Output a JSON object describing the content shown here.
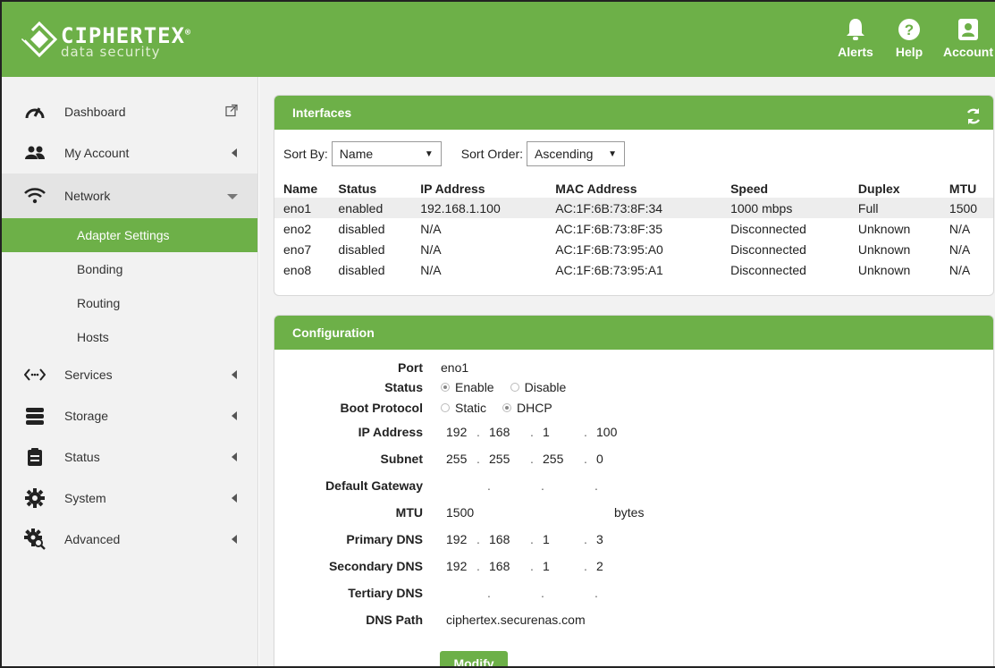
{
  "brand": {
    "name": "CIPHERTEX",
    "tagline": "data security",
    "registered": "®"
  },
  "header": {
    "alerts_label": "Alerts",
    "help_label": "Help",
    "account_label": "Account"
  },
  "sidebar": {
    "items": [
      {
        "label": "Dashboard",
        "icon": "speedometer-icon"
      },
      {
        "label": "My Account",
        "icon": "users-icon"
      },
      {
        "label": "Network",
        "icon": "wifi-icon"
      },
      {
        "label": "Services",
        "icon": "code-icon"
      },
      {
        "label": "Storage",
        "icon": "server-icon"
      },
      {
        "label": "Status",
        "icon": "clipboard-icon"
      },
      {
        "label": "System",
        "icon": "gear-icon"
      },
      {
        "label": "Advanced",
        "icon": "gear-search-icon"
      }
    ],
    "network_subitems": [
      "Adapter Settings",
      "Bonding",
      "Routing",
      "Hosts"
    ],
    "active_subitem": "Adapter Settings"
  },
  "interfaces": {
    "title": "Interfaces",
    "sort_by_label": "Sort By:",
    "sort_by_value": "Name",
    "sort_order_label": "Sort Order:",
    "sort_order_value": "Ascending",
    "columns": [
      "Name",
      "Status",
      "IP Address",
      "MAC Address",
      "Speed",
      "Duplex",
      "MTU"
    ],
    "rows": [
      [
        "eno1",
        "enabled",
        "192.168.1.100",
        "AC:1F:6B:73:8F:34",
        "1000 mbps",
        "Full",
        "1500"
      ],
      [
        "eno2",
        "disabled",
        "N/A",
        "AC:1F:6B:73:8F:35",
        "Disconnected",
        "Unknown",
        "N/A"
      ],
      [
        "eno7",
        "disabled",
        "N/A",
        "AC:1F:6B:73:95:A0",
        "Disconnected",
        "Unknown",
        "N/A"
      ],
      [
        "eno8",
        "disabled",
        "N/A",
        "AC:1F:6B:73:95:A1",
        "Disconnected",
        "Unknown",
        "N/A"
      ]
    ]
  },
  "configuration": {
    "title": "Configuration",
    "labels": {
      "port": "Port",
      "status": "Status",
      "boot_protocol": "Boot Protocol",
      "ip_address": "IP Address",
      "subnet": "Subnet",
      "default_gateway": "Default Gateway",
      "mtu": "MTU",
      "primary_dns": "Primary DNS",
      "secondary_dns": "Secondary DNS",
      "tertiary_dns": "Tertiary DNS",
      "dns_path": "DNS Path"
    },
    "port": "eno1",
    "status_options": [
      "Enable",
      "Disable"
    ],
    "status_selected": "Enable",
    "boot_options": [
      "Static",
      "DHCP"
    ],
    "boot_selected": "DHCP",
    "ip_address": [
      "192",
      "168",
      "1",
      "100"
    ],
    "subnet": [
      "255",
      "255",
      "255",
      "0"
    ],
    "default_gateway": [
      "",
      "",
      "",
      ""
    ],
    "mtu": "1500",
    "mtu_unit": "bytes",
    "primary_dns": [
      "192",
      "168",
      "1",
      "3"
    ],
    "secondary_dns": [
      "192",
      "168",
      "1",
      "2"
    ],
    "tertiary_dns": [
      "",
      "",
      "",
      ""
    ],
    "dns_path": "ciphertex.securenas.com",
    "modify_label": "Modify"
  },
  "colors": {
    "brand_green": "#6db048",
    "sidebar_bg": "#f2f2f2"
  }
}
